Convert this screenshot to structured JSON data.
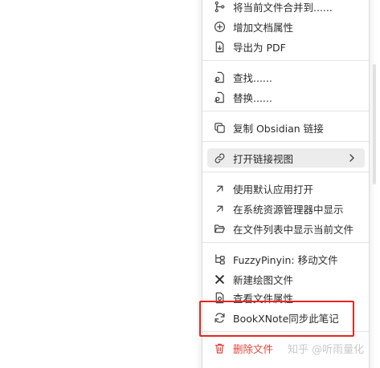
{
  "menu": {
    "items": [
      {
        "icon": "git-merge-icon",
        "label": "将当前文件合并到......"
      },
      {
        "icon": "plus-circle-icon",
        "label": "增加文档属性"
      },
      {
        "icon": "export-pdf-icon",
        "label": "导出为 PDF"
      },
      {
        "icon": "file-search-icon",
        "label": "查找......"
      },
      {
        "icon": "file-replace-icon",
        "label": "替换......"
      },
      {
        "icon": "copy-icon",
        "label": "复制 Obsidian 链接"
      },
      {
        "icon": "link-icon",
        "label": "打开链接视图"
      },
      {
        "icon": "arrow-up-right-icon",
        "label": "使用默认应用打开"
      },
      {
        "icon": "arrow-up-right-icon",
        "label": "在系统资源管理器中显示"
      },
      {
        "icon": "folder-open-icon",
        "label": "在文件列表中显示当前文件"
      },
      {
        "icon": "fuzzy-pinyin-icon",
        "label": "FuzzyPinyin: 移动文件"
      },
      {
        "icon": "drawing-icon",
        "label": "新建绘图文件"
      },
      {
        "icon": "file-properties-icon",
        "label": "查看文件属性"
      },
      {
        "icon": "sync-icon",
        "label": "BookXNote同步此笔记"
      },
      {
        "icon": "trash-icon",
        "label": "删除文件"
      }
    ],
    "submenu_indicator": "chevron-right-icon"
  },
  "watermark": "知乎 @听雨量化",
  "colors": {
    "danger": "#e0443a",
    "highlight": "#e8261e",
    "hover": "#ececec"
  }
}
